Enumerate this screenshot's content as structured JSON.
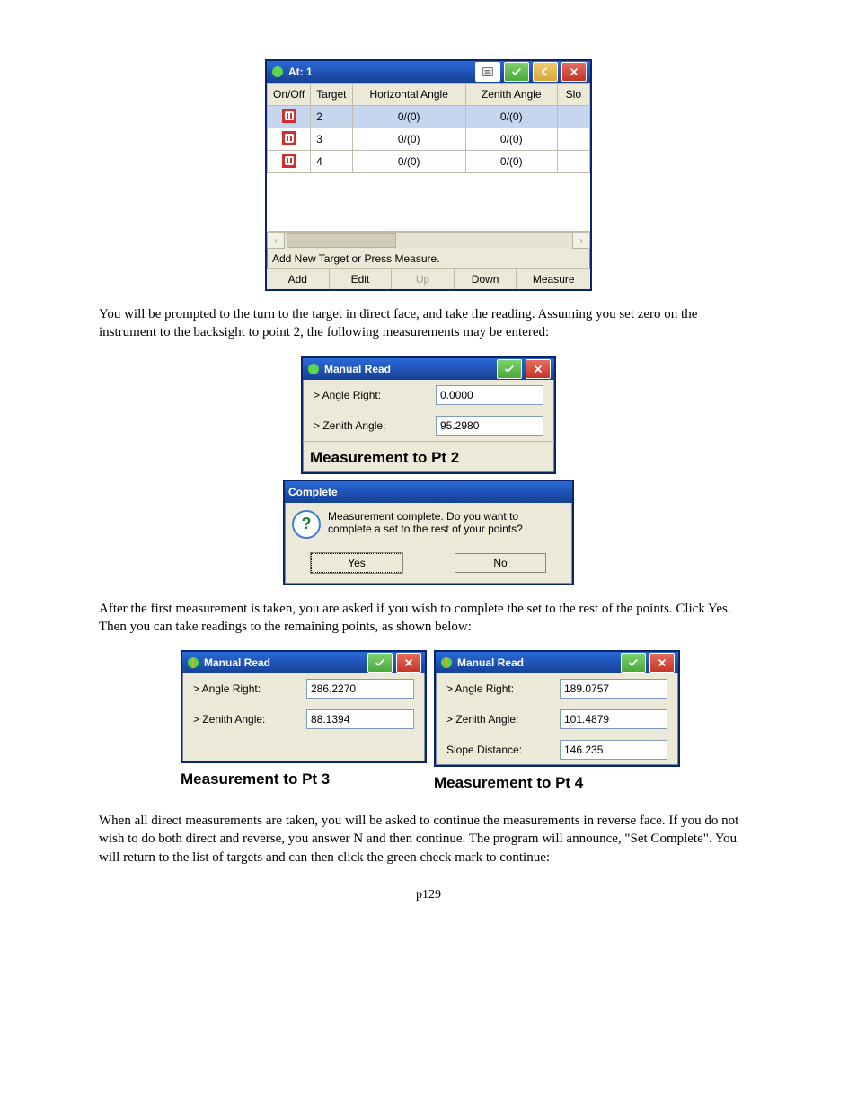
{
  "page_number": "p129",
  "top_win": {
    "title": "At: 1",
    "headers": [
      "On/Off",
      "Target",
      "Horizontal Angle",
      "Zenith Angle",
      "Slo"
    ],
    "rows": [
      {
        "target": "2",
        "hang": "0/(0)",
        "zang": "0/(0)",
        "selected": true
      },
      {
        "target": "3",
        "hang": "0/(0)",
        "zang": "0/(0)",
        "selected": false
      },
      {
        "target": "4",
        "hang": "0/(0)",
        "zang": "0/(0)",
        "selected": false
      }
    ],
    "status": "Add New Target or Press Measure.",
    "buttons": {
      "add": "Add",
      "edit": "Edit",
      "up": "Up",
      "down": "Down",
      "measure": "Measure"
    }
  },
  "para1": "You will be prompted to the turn to the target in direct face, and take the reading.  Assuming you set zero on the instrument to the backsight to point 2, the following measurements may be entered:",
  "manual_read_pt2": {
    "title": "Manual Read",
    "angle_right_label": "> Angle Right:",
    "angle_right_value": "0.0000",
    "zenith_label": "> Zenith Angle:",
    "zenith_value": "95.2980",
    "caption": "Measurement to Pt 2"
  },
  "complete_dialog": {
    "title": "Complete",
    "message": "Measurement complete. Do you want to complete a set to the rest of your points?",
    "yes_u": "Y",
    "yes_rest": "es",
    "no_u": "N",
    "no_rest": "o"
  },
  "para2": "After the first measurement is taken, you are asked if you wish to complete the set to the rest of the points.  Click Yes.  Then you can take readings to the remaining points, as shown below:",
  "manual_read_pt3": {
    "title": "Manual Read",
    "angle_right_label": "> Angle Right:",
    "angle_right_value": "286.2270",
    "zenith_label": "> Zenith Angle:",
    "zenith_value": "88.1394",
    "caption": "Measurement to Pt 3"
  },
  "manual_read_pt4": {
    "title": "Manual Read",
    "angle_right_label": "> Angle Right:",
    "angle_right_value": "189.0757",
    "zenith_label": "> Zenith Angle:",
    "zenith_value": "101.4879",
    "slope_label": "Slope Distance:",
    "slope_value": "146.235",
    "caption": "Measurement to Pt 4"
  },
  "para3": "When all direct measurements are taken, you will be asked to continue the measurements in reverse face.  If you do not wish to do both direct and reverse, you answer N and then continue.  The program will announce, \"Set Complete\".  You will return to the list of targets and can then click the green check mark to continue:"
}
